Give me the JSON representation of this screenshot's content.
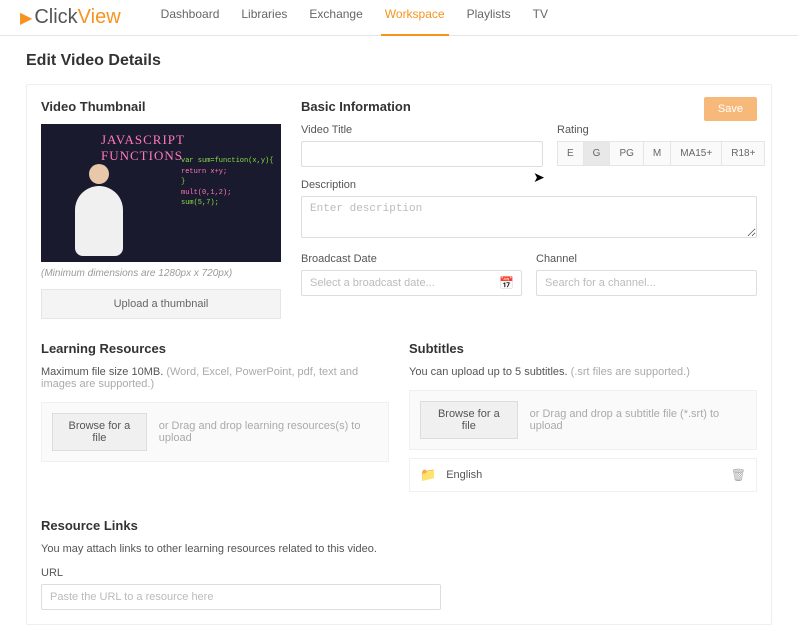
{
  "logo": {
    "part1": "Click",
    "part2": "View"
  },
  "nav": [
    "Dashboard",
    "Libraries",
    "Exchange",
    "Workspace",
    "Playlists",
    "TV"
  ],
  "nav_active": 3,
  "page_title": "Edit Video Details",
  "thumbnail": {
    "heading": "Video Thumbnail",
    "overlay_title": "JAVASCRIPT FUNCTIONS",
    "code_lines": [
      "var sum=function(x,y){",
      "  return x+y;",
      "}",
      "mult(0,1,2);",
      "sum(5,7);"
    ],
    "min_note": "(Minimum dimensions are 1280px x 720px)",
    "upload": "Upload a thumbnail"
  },
  "basic": {
    "heading": "Basic Information",
    "save": "Save",
    "title_label": "Video Title",
    "title_value": "",
    "rating_label": "Rating",
    "ratings": [
      "E",
      "G",
      "PG",
      "M",
      "MA15+",
      "R18+"
    ],
    "rating_selected": "G",
    "desc_label": "Description",
    "desc_placeholder": "Enter description",
    "date_label": "Broadcast Date",
    "date_placeholder": "Select a broadcast date...",
    "channel_label": "Channel",
    "channel_placeholder": "Search for a channel..."
  },
  "learning": {
    "heading": "Learning Resources",
    "hint_main": "Maximum file size 10MB.",
    "hint_muted": "(Word, Excel, PowerPoint, pdf, text and images are supported.)",
    "browse": "Browse for a file",
    "drag": "or Drag and drop learning resources(s) to upload"
  },
  "subtitles": {
    "heading": "Subtitles",
    "hint_main": "You can upload up to 5 subtitles.",
    "hint_muted": "(.srt files are supported.)",
    "browse": "Browse for a file",
    "drag": "or Drag and drop a subtitle file (*.srt) to upload",
    "items": [
      {
        "name": "English"
      }
    ]
  },
  "links": {
    "heading": "Resource Links",
    "hint": "You may attach links to other learning resources related to this video.",
    "url_label": "URL",
    "url_placeholder": "Paste the URL to a resource here"
  }
}
